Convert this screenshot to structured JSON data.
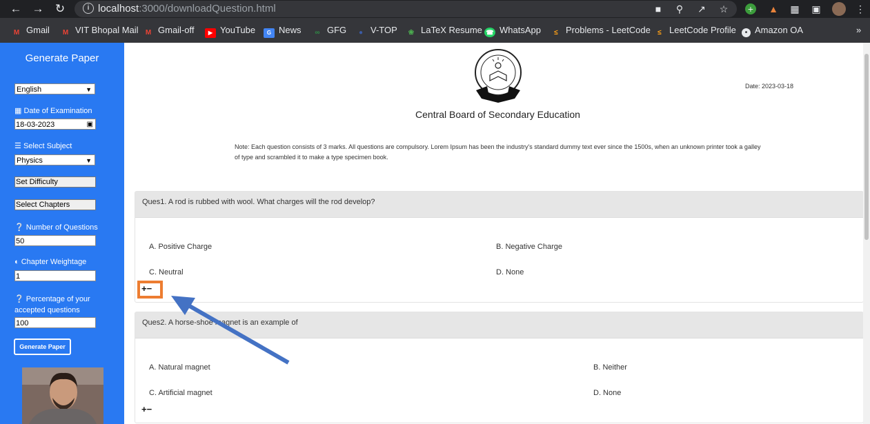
{
  "browser": {
    "url_host": "localhost",
    "url_rest": ":3000/downloadQuestion.html",
    "bookmarks": [
      "Gmail",
      "VIT Bhopal Mail",
      "Gmail-off",
      "YouTube",
      "News",
      "GFG",
      "V-TOP",
      "LaTeX Resume",
      "WhatsApp",
      "Problems - LeetCode",
      "LeetCode Profile",
      "Amazon OA"
    ],
    "more": "»"
  },
  "sidebar": {
    "title": "Generate Paper",
    "language": "English",
    "date_label": "Date of Examination",
    "date_value": "18-03-2023",
    "subject_label": "Select Subject",
    "subject_value": "Physics",
    "difficulty_btn": "Set Difficulty",
    "chapters_btn": "Select Chapters",
    "num_questions_label": "Number of Questions",
    "num_questions_value": "50",
    "weightage_label": "Chapter Weightage",
    "weightage_value": "1",
    "percentage_label": "Percentage of your accepted questions",
    "percentage_value": "100",
    "generate_btn": "Generate Paper"
  },
  "paper": {
    "date": "Date: 2023-03-18",
    "board": "Central Board of Secondary Education",
    "note": "Note: Each question consists of 3 marks. All questions are compulsory. Lorem Ipsum has been the industry's standard dummy text ever since the 1500s, when an unknown printer took a galley of type and scrambled it to make a type specimen book.",
    "questions": [
      {
        "text": "Ques1. A rod is rubbed with wool. What charges will the rod develop?",
        "options": [
          "A. Positive Charge",
          "B. Negative Charge",
          "C. Neutral",
          "D. None"
        ]
      },
      {
        "text": "Ques2. A horse-shoe magnet is an example of",
        "options": [
          "A. Natural magnet",
          "B. Neither",
          "C. Artificial magnet",
          "D. None"
        ]
      }
    ],
    "plus": "+",
    "minus": "−"
  },
  "colors": {
    "sidebar": "#2979f2",
    "highlight": "#ed7d31",
    "arrow": "#4472c4"
  }
}
